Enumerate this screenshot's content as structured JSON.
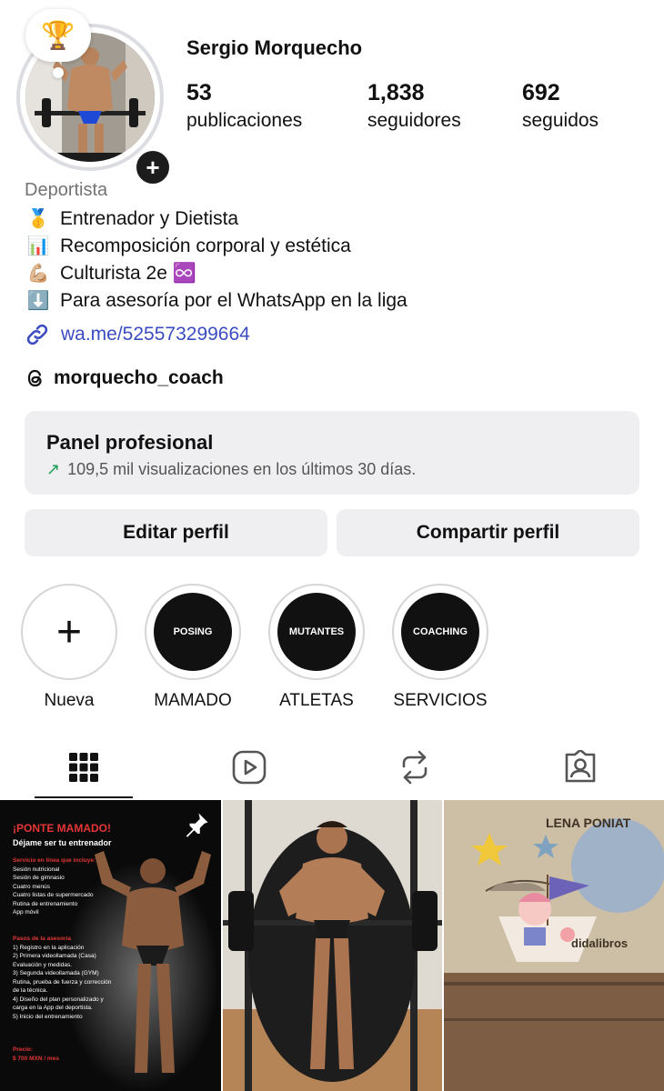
{
  "profile": {
    "username": "Sergio Morquecho",
    "note_emoji": "🏆",
    "add_symbol": "+",
    "stats": [
      {
        "value": "53",
        "label": "publicaciones"
      },
      {
        "value": "1,838",
        "label": "seguidores"
      },
      {
        "value": "692",
        "label": "seguidos"
      }
    ],
    "category": "Deportista",
    "bio": [
      {
        "emoji": "🥇",
        "text": "Entrenador y Dietista"
      },
      {
        "emoji": "📊",
        "text": "Recomposición corporal y estética"
      },
      {
        "emoji": "💪🏼",
        "text": "Culturista 2e ♾️"
      },
      {
        "emoji": "⬇️",
        "text": "Para asesoría por el WhatsApp en la liga"
      }
    ],
    "link": "wa.me/525573299664",
    "threads_handle": "morquecho_coach"
  },
  "panel": {
    "title": "Panel profesional",
    "arrow": "↗",
    "subtitle": "109,5 mil visualizaciones en los últimos 30 días."
  },
  "buttons": {
    "edit": "Editar perfil",
    "share": "Compartir perfil"
  },
  "highlights": [
    {
      "cover": "",
      "label": "Nueva"
    },
    {
      "cover": "POSING",
      "label": "MAMADO"
    },
    {
      "cover": "MUTANTES",
      "label": "ATLETAS"
    },
    {
      "cover": "COACHING",
      "label": "SERVICIOS"
    }
  ],
  "highlights_new_symbol": "+",
  "tabs": [
    "grid-icon",
    "reels-icon",
    "reposts-icon",
    "tagged-icon"
  ],
  "posts": {
    "post1": {
      "title": "¡PONTE MAMADO!",
      "subtitle": "Déjame ser tu entrenador",
      "section1_title": "Servicio en línea que incluye:",
      "section1_items": [
        "Sesión nutricional",
        "Sesión de gimnasio",
        "Cuatro menús",
        "Cuatro listas de supermercado",
        "Rutina de entrenamiento",
        "App móvil"
      ],
      "section2_title": "Pasos de la asesoría",
      "section2_items": [
        "1) Registro en la aplicación",
        "2) Primera videollamada (Casa)",
        "Evaluación y medidas.",
        "3) Segunda videollamada (GYM)",
        "Rutina, prueba de fuerza y corrección de la técnica.",
        "4) Diseño del plan personalizado y carga en la App del deportista.",
        "5) Inicio del entrenamiento"
      ],
      "price_label": "Precio:",
      "price": "$ 700 MXN / mes"
    },
    "post3": {
      "book_text": "LENA PONIAT",
      "book_text2": "didalibros"
    }
  },
  "colors": {
    "accent_link": "#3b4cc0",
    "panel_bg": "#efeff1",
    "trend_green": "#1a9e55",
    "post_red": "#e53636"
  }
}
